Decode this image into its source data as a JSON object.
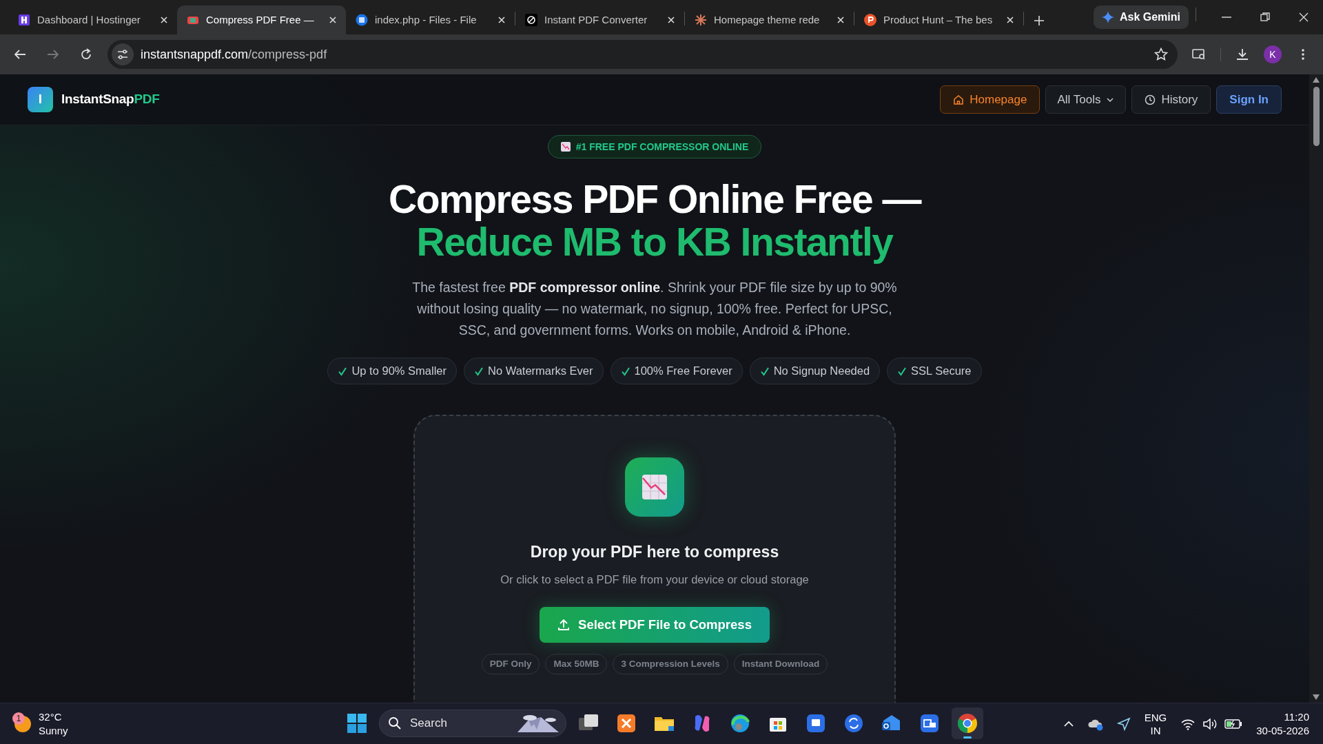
{
  "browser": {
    "tabs": [
      {
        "title": "Dashboard | Hostinger",
        "selected": false
      },
      {
        "title": "Compress PDF Free —",
        "selected": true
      },
      {
        "title": "index.php - Files - File",
        "selected": false
      },
      {
        "title": "Instant PDF Converter",
        "selected": false
      },
      {
        "title": "Homepage theme rede",
        "selected": false
      },
      {
        "title": "Product Hunt – The bes",
        "selected": false
      }
    ],
    "ask_button": "Ask Gemini",
    "address": {
      "domain": "instantsnappdf.com",
      "path": "/compress-pdf"
    },
    "profile_initial": "K"
  },
  "site": {
    "logo_letter": "I",
    "brand_main": "InstantSnap",
    "brand_accent": "PDF",
    "nav": [
      {
        "label": "Homepage",
        "kind": "home"
      },
      {
        "label": "All Tools",
        "kind": "dropdown"
      },
      {
        "label": "History",
        "kind": "history"
      },
      {
        "label": "Sign In",
        "kind": "signin"
      }
    ]
  },
  "hero": {
    "badge": "#1 FREE PDF COMPRESSOR ONLINE",
    "title_line1": "Compress PDF Online Free —",
    "title_line2": "Reduce MB to KB Instantly",
    "description": "The fastest free **PDF compressor online**. Shrink your PDF file size by up to 90% without losing quality — no watermark, no signup, 100% free. Perfect for UPSC, SSC, and government forms. Works on mobile, Android & iPhone.",
    "features": [
      "Up to 90% Smaller",
      "No Watermarks Ever",
      "100% Free Forever",
      "No Signup Needed",
      "SSL Secure"
    ]
  },
  "upload": {
    "heading": "Drop your PDF here to compress",
    "subtext": "Or click to select a PDF file from your device or cloud storage",
    "button": "Select PDF File to Compress",
    "tags": [
      "PDF Only",
      "Max 50MB",
      "3 Compression Levels",
      "Instant Download"
    ]
  },
  "taskbar": {
    "weather": {
      "badge": "1",
      "temp": "32°C",
      "condition": "Sunny"
    },
    "search": {
      "placeholder": "Search"
    },
    "apps": [
      {
        "selected": false
      },
      {
        "selected": false
      },
      {
        "selected": false
      },
      {
        "selected": false
      },
      {
        "selected": false
      },
      {
        "selected": false
      },
      {
        "selected": false
      },
      {
        "selected": false
      },
      {
        "selected": false
      },
      {
        "selected": false
      },
      {
        "selected": true
      }
    ],
    "language": "ENG",
    "region": "IN",
    "time": "11:20",
    "date": "30-05-2026"
  }
}
